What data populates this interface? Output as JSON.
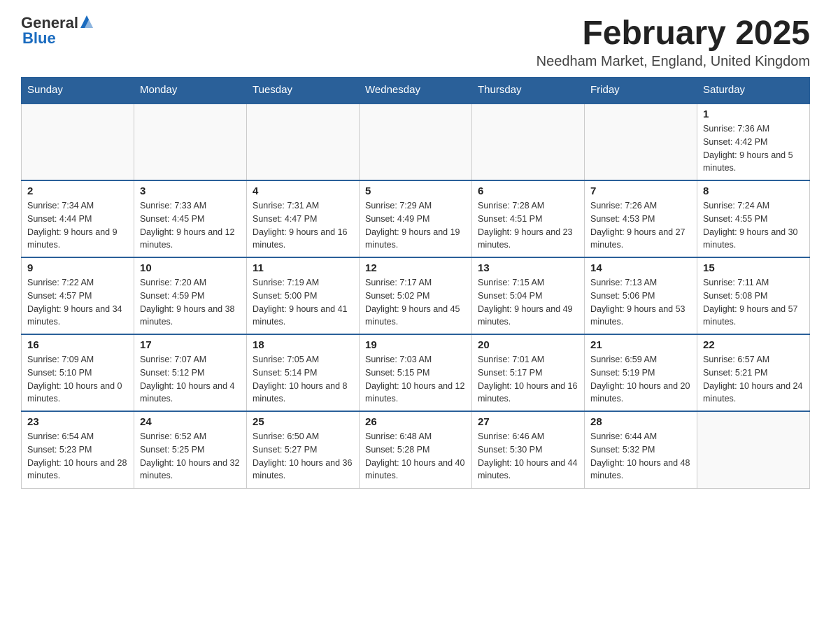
{
  "header": {
    "logo_general": "General",
    "logo_blue": "Blue",
    "month_title": "February 2025",
    "location": "Needham Market, England, United Kingdom"
  },
  "days_of_week": [
    "Sunday",
    "Monday",
    "Tuesday",
    "Wednesday",
    "Thursday",
    "Friday",
    "Saturday"
  ],
  "weeks": [
    [
      {
        "day": "",
        "info": ""
      },
      {
        "day": "",
        "info": ""
      },
      {
        "day": "",
        "info": ""
      },
      {
        "day": "",
        "info": ""
      },
      {
        "day": "",
        "info": ""
      },
      {
        "day": "",
        "info": ""
      },
      {
        "day": "1",
        "info": "Sunrise: 7:36 AM\nSunset: 4:42 PM\nDaylight: 9 hours and 5 minutes."
      }
    ],
    [
      {
        "day": "2",
        "info": "Sunrise: 7:34 AM\nSunset: 4:44 PM\nDaylight: 9 hours and 9 minutes."
      },
      {
        "day": "3",
        "info": "Sunrise: 7:33 AM\nSunset: 4:45 PM\nDaylight: 9 hours and 12 minutes."
      },
      {
        "day": "4",
        "info": "Sunrise: 7:31 AM\nSunset: 4:47 PM\nDaylight: 9 hours and 16 minutes."
      },
      {
        "day": "5",
        "info": "Sunrise: 7:29 AM\nSunset: 4:49 PM\nDaylight: 9 hours and 19 minutes."
      },
      {
        "day": "6",
        "info": "Sunrise: 7:28 AM\nSunset: 4:51 PM\nDaylight: 9 hours and 23 minutes."
      },
      {
        "day": "7",
        "info": "Sunrise: 7:26 AM\nSunset: 4:53 PM\nDaylight: 9 hours and 27 minutes."
      },
      {
        "day": "8",
        "info": "Sunrise: 7:24 AM\nSunset: 4:55 PM\nDaylight: 9 hours and 30 minutes."
      }
    ],
    [
      {
        "day": "9",
        "info": "Sunrise: 7:22 AM\nSunset: 4:57 PM\nDaylight: 9 hours and 34 minutes."
      },
      {
        "day": "10",
        "info": "Sunrise: 7:20 AM\nSunset: 4:59 PM\nDaylight: 9 hours and 38 minutes."
      },
      {
        "day": "11",
        "info": "Sunrise: 7:19 AM\nSunset: 5:00 PM\nDaylight: 9 hours and 41 minutes."
      },
      {
        "day": "12",
        "info": "Sunrise: 7:17 AM\nSunset: 5:02 PM\nDaylight: 9 hours and 45 minutes."
      },
      {
        "day": "13",
        "info": "Sunrise: 7:15 AM\nSunset: 5:04 PM\nDaylight: 9 hours and 49 minutes."
      },
      {
        "day": "14",
        "info": "Sunrise: 7:13 AM\nSunset: 5:06 PM\nDaylight: 9 hours and 53 minutes."
      },
      {
        "day": "15",
        "info": "Sunrise: 7:11 AM\nSunset: 5:08 PM\nDaylight: 9 hours and 57 minutes."
      }
    ],
    [
      {
        "day": "16",
        "info": "Sunrise: 7:09 AM\nSunset: 5:10 PM\nDaylight: 10 hours and 0 minutes."
      },
      {
        "day": "17",
        "info": "Sunrise: 7:07 AM\nSunset: 5:12 PM\nDaylight: 10 hours and 4 minutes."
      },
      {
        "day": "18",
        "info": "Sunrise: 7:05 AM\nSunset: 5:14 PM\nDaylight: 10 hours and 8 minutes."
      },
      {
        "day": "19",
        "info": "Sunrise: 7:03 AM\nSunset: 5:15 PM\nDaylight: 10 hours and 12 minutes."
      },
      {
        "day": "20",
        "info": "Sunrise: 7:01 AM\nSunset: 5:17 PM\nDaylight: 10 hours and 16 minutes."
      },
      {
        "day": "21",
        "info": "Sunrise: 6:59 AM\nSunset: 5:19 PM\nDaylight: 10 hours and 20 minutes."
      },
      {
        "day": "22",
        "info": "Sunrise: 6:57 AM\nSunset: 5:21 PM\nDaylight: 10 hours and 24 minutes."
      }
    ],
    [
      {
        "day": "23",
        "info": "Sunrise: 6:54 AM\nSunset: 5:23 PM\nDaylight: 10 hours and 28 minutes."
      },
      {
        "day": "24",
        "info": "Sunrise: 6:52 AM\nSunset: 5:25 PM\nDaylight: 10 hours and 32 minutes."
      },
      {
        "day": "25",
        "info": "Sunrise: 6:50 AM\nSunset: 5:27 PM\nDaylight: 10 hours and 36 minutes."
      },
      {
        "day": "26",
        "info": "Sunrise: 6:48 AM\nSunset: 5:28 PM\nDaylight: 10 hours and 40 minutes."
      },
      {
        "day": "27",
        "info": "Sunrise: 6:46 AM\nSunset: 5:30 PM\nDaylight: 10 hours and 44 minutes."
      },
      {
        "day": "28",
        "info": "Sunrise: 6:44 AM\nSunset: 5:32 PM\nDaylight: 10 hours and 48 minutes."
      },
      {
        "day": "",
        "info": ""
      }
    ]
  ]
}
